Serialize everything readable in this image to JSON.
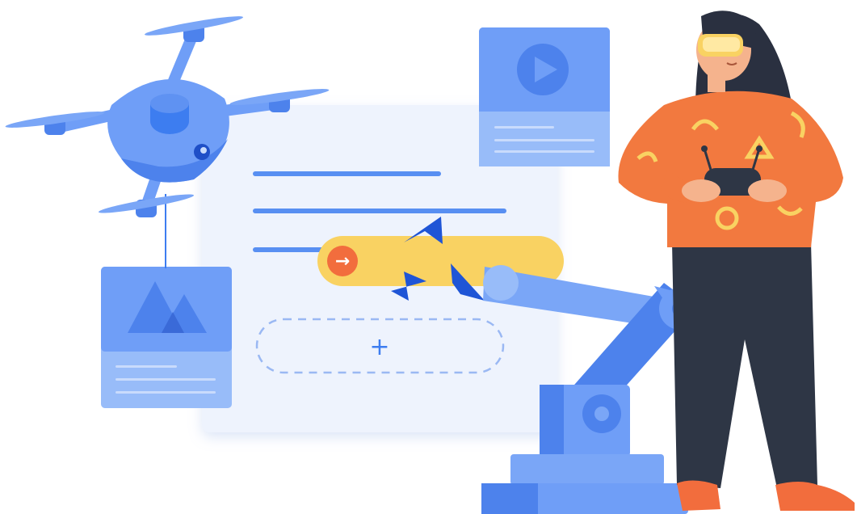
{
  "scene": {
    "description_label": "",
    "add_block_symbol": "+",
    "next_step_symbol": "→"
  },
  "colors": {
    "panel_bg": "#eef3fd",
    "accent_blue": "#3d7df0",
    "light_blue": "#7aa6f7",
    "card_blue": "#6f9ef7",
    "yellow_bar": "#f9d262",
    "orange": "#f26d3d",
    "sweater_orange": "#f2793f",
    "pants_dark": "#2e3645",
    "hair_dark": "#2a3040",
    "skin": "#f5b38d"
  },
  "icons": [
    "play-icon",
    "mountain-image-icon",
    "plus-icon",
    "arrow-right-icon",
    "cursor-icon"
  ]
}
